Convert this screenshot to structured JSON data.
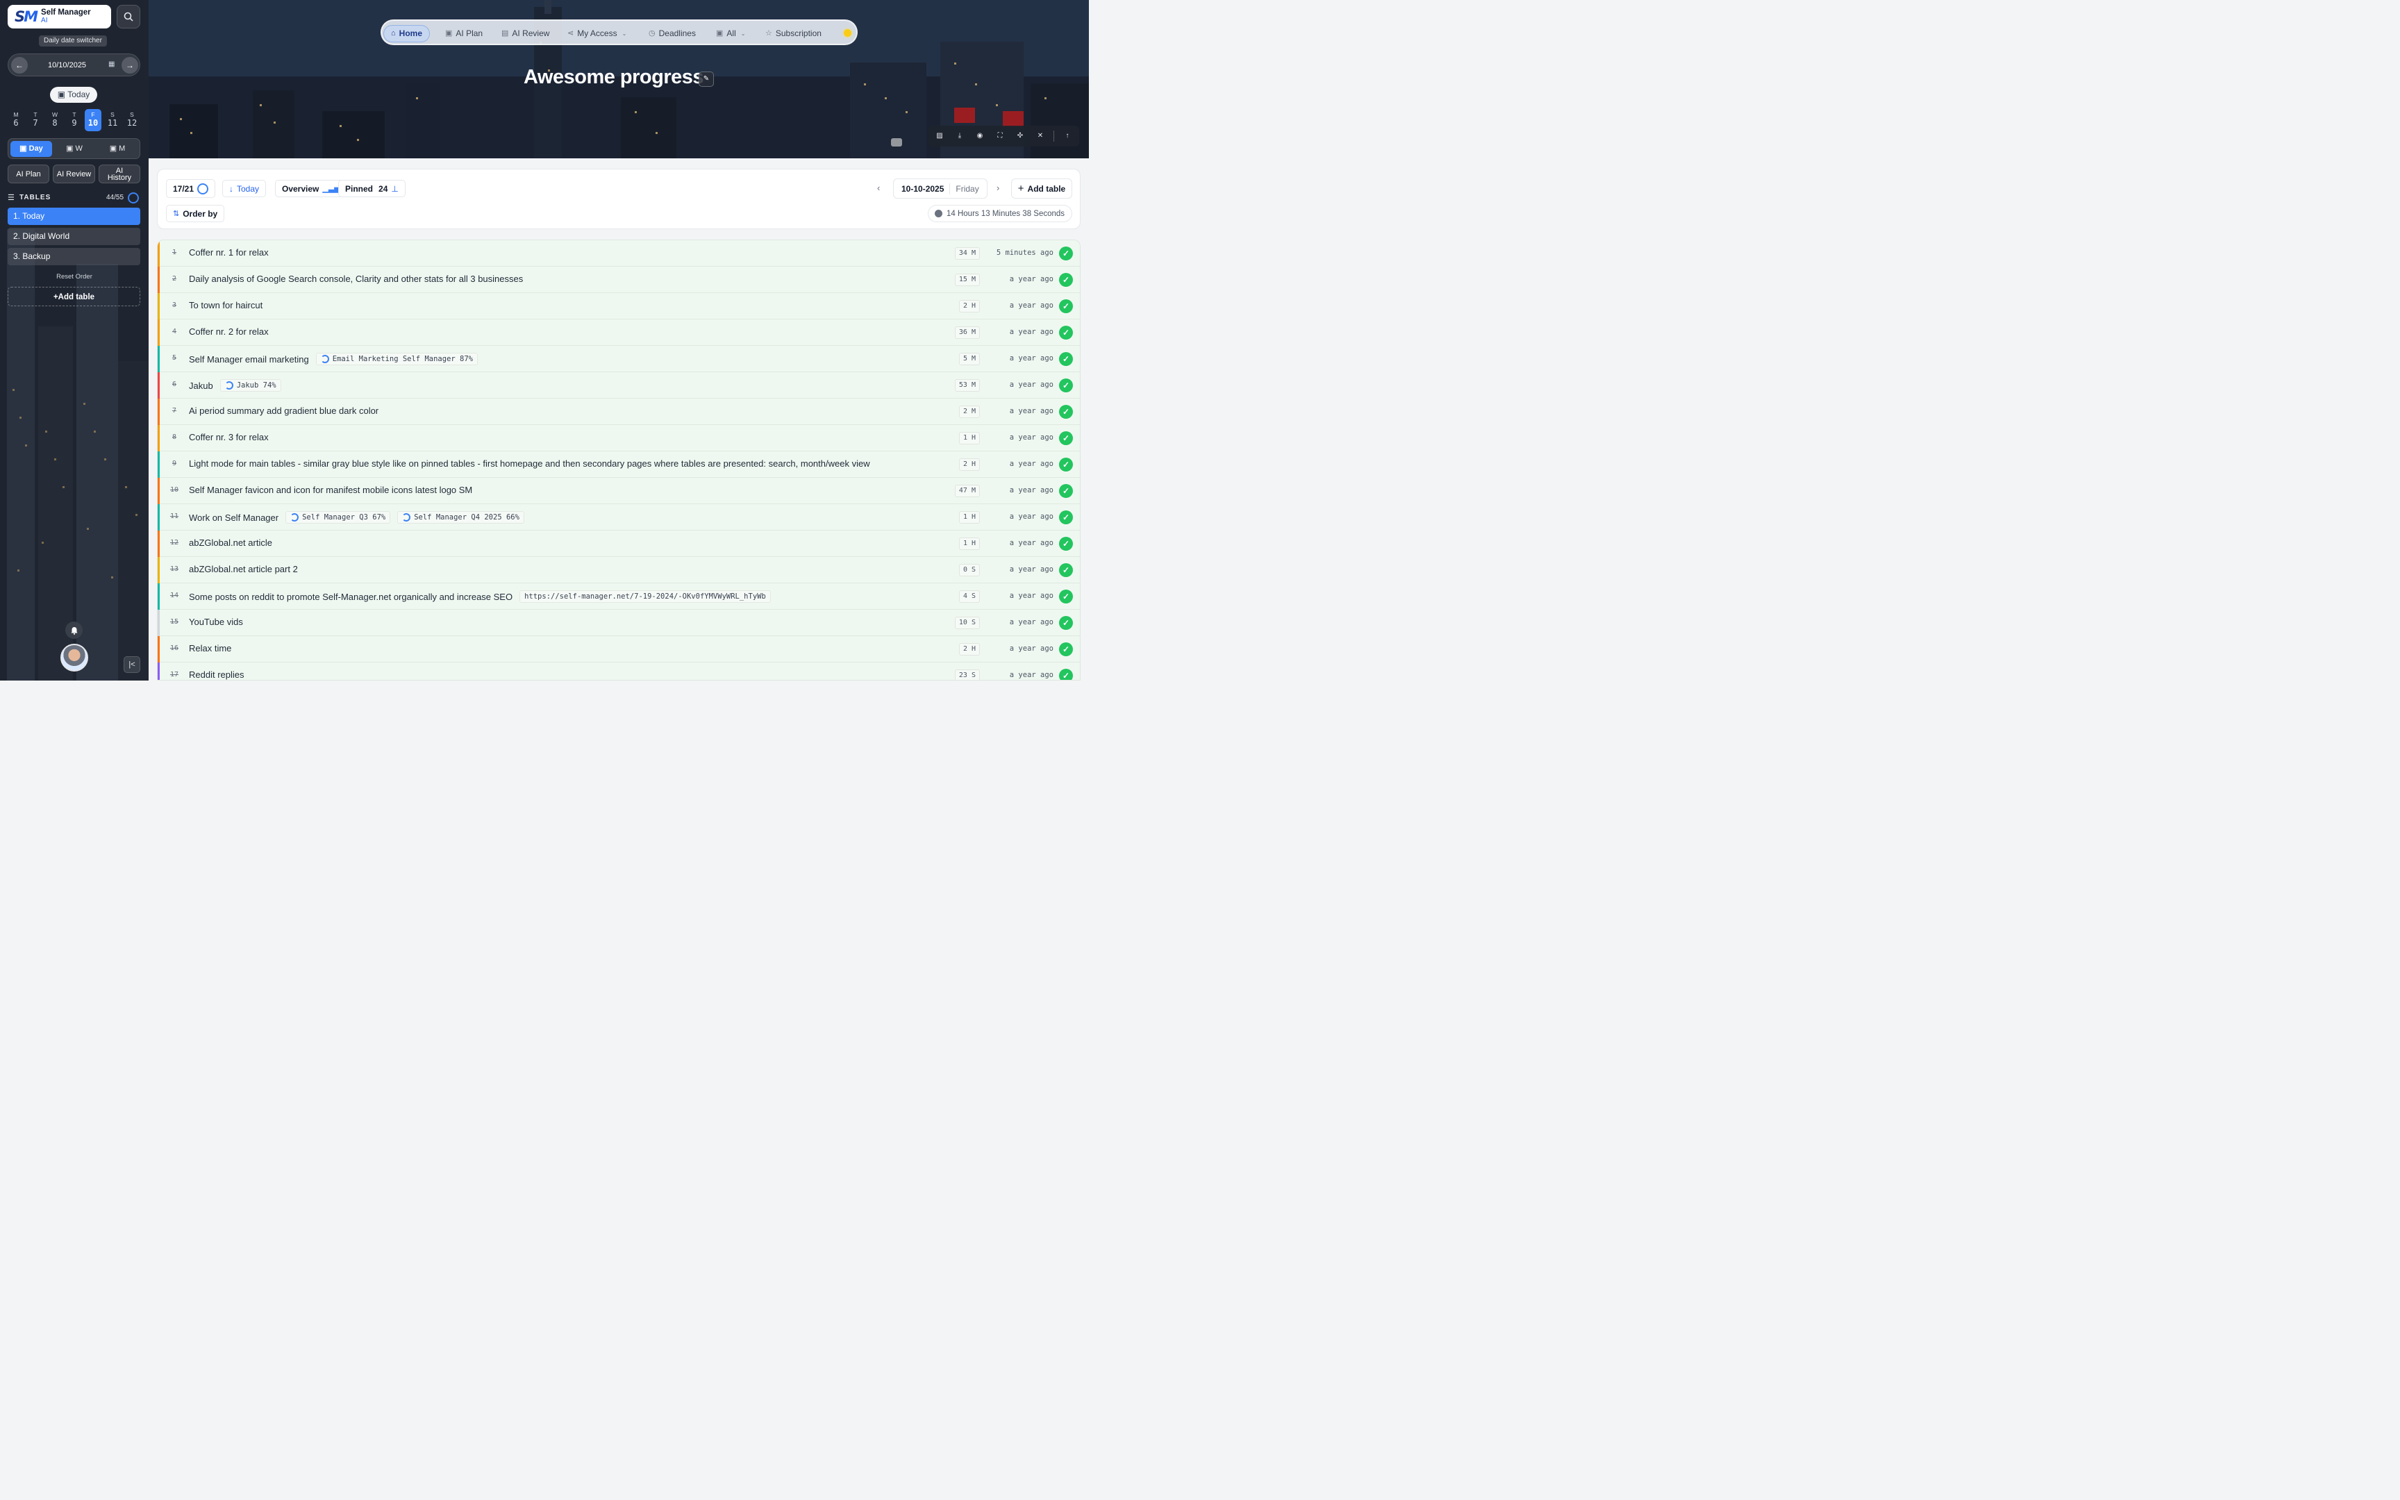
{
  "sidebar": {
    "logo_text": "Self Manager",
    "logo_sub": "AI",
    "switcher_label": "Daily date switcher",
    "date_value": "10/10/2025",
    "today_button": "Today",
    "week_days": [
      {
        "letter": "M",
        "num": "6"
      },
      {
        "letter": "T",
        "num": "7"
      },
      {
        "letter": "W",
        "num": "8"
      },
      {
        "letter": "T",
        "num": "9"
      },
      {
        "letter": "F",
        "num": "10"
      },
      {
        "letter": "S",
        "num": "11"
      },
      {
        "letter": "S",
        "num": "12"
      }
    ],
    "view_modes": [
      "Day",
      "W",
      "M"
    ],
    "ai_plan": "AI Plan",
    "ai_review": "AI Review",
    "ai_history": "AI History",
    "tables_title": "TABLES",
    "tables_count": "44/55",
    "tables": [
      "1. Today",
      "2. Digital World",
      "3. Backup"
    ],
    "reset_order": "Reset Order",
    "add_table": "+Add table"
  },
  "nav": {
    "items": [
      {
        "label": "Home",
        "icon": "home-icon"
      },
      {
        "label": "AI Plan",
        "icon": "calendar-icon"
      },
      {
        "label": "AI Review",
        "icon": "list-icon"
      },
      {
        "label": "My Access",
        "icon": "share-icon"
      },
      {
        "label": "Deadlines",
        "icon": "clock-icon"
      },
      {
        "label": "All",
        "icon": "calendar-icon"
      },
      {
        "label": "Subscription",
        "icon": "star-icon"
      }
    ]
  },
  "hero": {
    "title": "Awesome progress"
  },
  "toolbar": {
    "progress": "17/21",
    "today": "Today",
    "overview": "Overview",
    "pinned_label": "Pinned",
    "pinned_count": "24",
    "order_by": "Order by",
    "date": "10-10-2025",
    "day_name": "Friday",
    "add_table": "Add table",
    "timer": "14 Hours 13 Minutes 38 Seconds"
  },
  "tasks": [
    {
      "num": "1",
      "title": "Coffer nr. 1 for relax",
      "tags": [],
      "duration": "34 M",
      "ago": "5 minutes ago",
      "color": "#f59e0b"
    },
    {
      "num": "2",
      "title": "Daily analysis of Google Search console, Clarity and other stats for all 3 businesses",
      "tags": [],
      "duration": "15 M",
      "ago": "a year ago",
      "color": "#f97316"
    },
    {
      "num": "3",
      "title": "To town for haircut",
      "tags": [],
      "duration": "2 H",
      "ago": "a year ago",
      "color": "#eab308"
    },
    {
      "num": "4",
      "title": "Coffer nr. 2 for relax",
      "tags": [],
      "duration": "36 M",
      "ago": "a year ago",
      "color": "#f59e0b"
    },
    {
      "num": "5",
      "title": "Self Manager email marketing",
      "tags": [
        "Email Marketing Self Manager 87%"
      ],
      "duration": "5 M",
      "ago": "a year ago",
      "color": "#14b8a6"
    },
    {
      "num": "6",
      "title": "Jakub",
      "tags": [
        "Jakub 74%"
      ],
      "duration": "53 M",
      "ago": "a year ago",
      "color": "#ef4444"
    },
    {
      "num": "7",
      "title": "Ai period summary add gradient blue dark color",
      "tags": [],
      "duration": "2 M",
      "ago": "a year ago",
      "color": "#f97316"
    },
    {
      "num": "8",
      "title": "Coffer nr. 3 for relax",
      "tags": [],
      "duration": "1 H",
      "ago": "a year ago",
      "color": "#f59e0b"
    },
    {
      "num": "9",
      "title": "Light mode for main tables - similar gray blue style like on pinned tables - first homepage and then secondary pages where tables are presented: search, month/week view",
      "tags": [],
      "duration": "2 H",
      "ago": "a year ago",
      "color": "#14b8a6"
    },
    {
      "num": "10",
      "title": "Self Manager favicon and icon for manifest mobile icons latest logo SM",
      "tags": [],
      "duration": "47 M",
      "ago": "a year ago",
      "color": "#f97316"
    },
    {
      "num": "11",
      "title": "Work on Self Manager",
      "tags": [
        "Self Manager Q3 67%",
        "Self Manager Q4 2025 66%"
      ],
      "duration": "1 H",
      "ago": "a year ago",
      "color": "#14b8a6"
    },
    {
      "num": "12",
      "title": "abZGlobal.net article",
      "tags": [],
      "duration": "1 H",
      "ago": "a year ago",
      "color": "#f97316"
    },
    {
      "num": "13",
      "title": "abZGlobal.net article part 2",
      "tags": [],
      "duration": "0 S",
      "ago": "a year ago",
      "color": "#eab308"
    },
    {
      "num": "14",
      "title": "Some posts on reddit to promote Self-Manager.net organically and increase SEO",
      "tags": [
        "https://self-manager.net/7-19-2024/-OKv0fYMVWyWRL_hTyWb"
      ],
      "duration": "4 S",
      "ago": "a year ago",
      "color": "#14b8a6"
    },
    {
      "num": "15",
      "title": "YouTube vids",
      "tags": [],
      "duration": "10 S",
      "ago": "a year ago",
      "color": "#d1d5db"
    },
    {
      "num": "16",
      "title": "Relax time",
      "tags": [],
      "duration": "2 H",
      "ago": "a year ago",
      "color": "#f97316"
    },
    {
      "num": "17",
      "title": "Reddit replies",
      "tags": [],
      "duration": "23 S",
      "ago": "a year ago",
      "color": "#8b5cf6"
    }
  ]
}
